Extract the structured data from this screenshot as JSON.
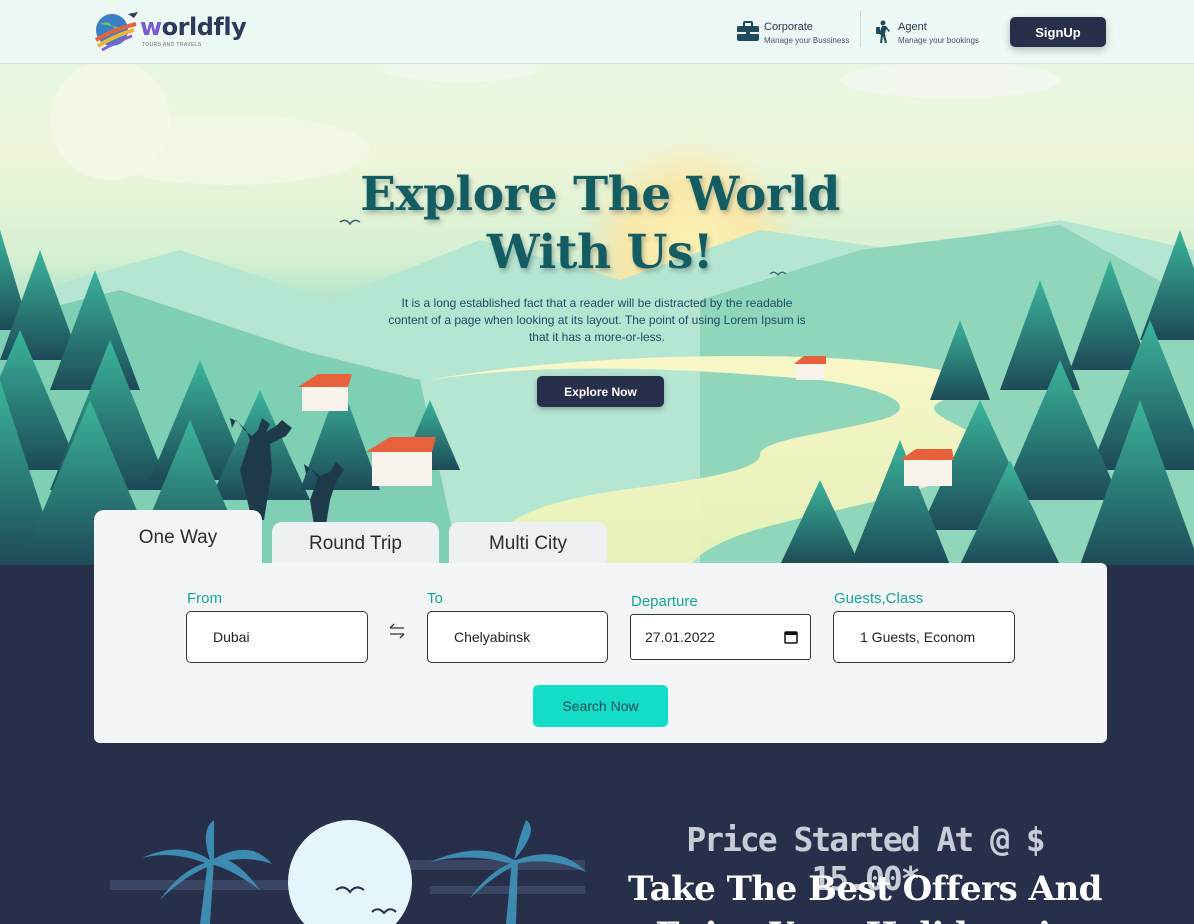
{
  "brand": {
    "name_prefix": "w",
    "name_rest": "orldfly",
    "tagline": "TOURS AND TRAVELS",
    "colors": {
      "navy": "#272f4b",
      "teal": "#16a598",
      "aqua": "#13ddc6"
    }
  },
  "header": {
    "corporate": {
      "title": "Corporate",
      "subtitle": "Manage your Bussiness",
      "icon": "briefcase-icon"
    },
    "agent": {
      "title": "Agent",
      "subtitle": "Manage your bookings",
      "icon": "hiker-icon"
    },
    "signup_label": "SignUp"
  },
  "hero": {
    "title_line1": "Explore The World",
    "title_line2": "With Us!",
    "description": "It is a long established fact that a reader will be distracted by the readable content of a page when looking at its layout. The point of using Lorem Ipsum is that it has a more-or-less.",
    "explore_label": "Explore Now"
  },
  "search": {
    "tabs": [
      {
        "label": "One Way",
        "active": true
      },
      {
        "label": "Round Trip",
        "active": false
      },
      {
        "label": "Multi City",
        "active": false
      }
    ],
    "from": {
      "label": "From",
      "value": "Dubai"
    },
    "to": {
      "label": "To",
      "value": "Chelyabinsk"
    },
    "departure": {
      "label": "Departure",
      "value": "27.01.2022"
    },
    "guests": {
      "label": "Guests,Class",
      "value": "1 Guests, Econom"
    },
    "search_label": "Search Now"
  },
  "offers": {
    "price_line": "Price Started At @ $ 15.00*",
    "title": "Take The Best Offers And Enjoy Your Holidays in"
  }
}
